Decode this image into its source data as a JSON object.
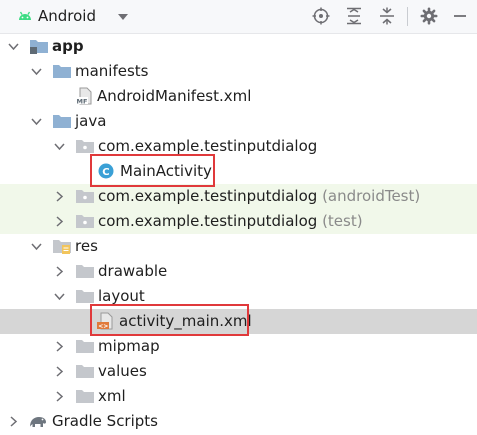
{
  "toolbar": {
    "view_label": "Android",
    "icons": [
      "android-icon",
      "dropdown-chevron-icon",
      "locate-icon",
      "expand-all-icon",
      "collapse-all-icon",
      "gear-icon",
      "minimize-icon"
    ]
  },
  "tree": {
    "app": "app",
    "manifests": "manifests",
    "manifest_file": "AndroidManifest.xml",
    "java": "java",
    "pkg_main": "com.example.testinputdialog",
    "main_activity": "MainActivity",
    "pkg_android_test": "com.example.testinputdialog",
    "pkg_android_test_suffix": "(androidTest)",
    "pkg_test": "com.example.testinputdialog",
    "pkg_test_suffix": "(test)",
    "res": "res",
    "drawable": "drawable",
    "layout": "layout",
    "layout_file": "activity_main.xml",
    "mipmap": "mipmap",
    "values": "values",
    "xml": "xml",
    "gradle": "Gradle Scripts"
  },
  "colors": {
    "highlight_box": "#e0393b",
    "test_row_bg": "#f1f8ea",
    "selected_row_bg": "#d6d6d6",
    "folder_blue": "#8fb1d3",
    "class_icon": "#3aa0d6"
  }
}
